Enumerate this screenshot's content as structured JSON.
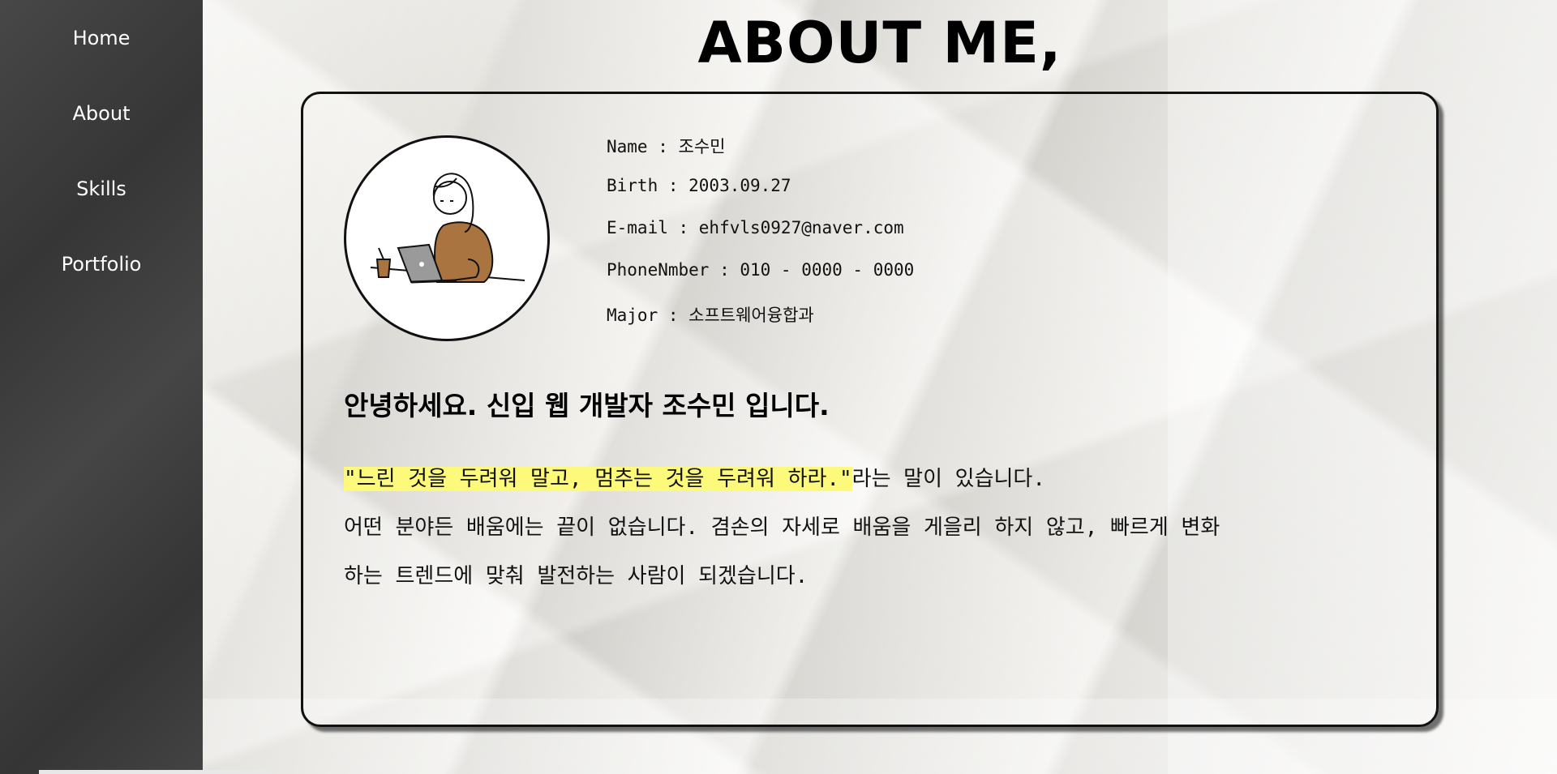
{
  "nav": {
    "items": [
      {
        "label": "Home"
      },
      {
        "label": "About"
      },
      {
        "label": "Skills"
      },
      {
        "label": "Portfolio"
      }
    ]
  },
  "page": {
    "title": "ABOUT ME,"
  },
  "profile": {
    "avatar_icon": "person-with-laptop-illustration",
    "name": "Name : 조수민",
    "birth": "Birth : 2003.09.27",
    "email": "E-mail : ehfvls0927@naver.com",
    "phone": "PhoneNmber : 010 - 0000 - 0000",
    "major": "Major : 소프트웨어융합과"
  },
  "intro": {
    "greeting": "안녕하세요. 신입 웹 개발자 조수민 입니다.",
    "quote": "\"느린 것을 두려워 말고, 멈추는 것을 두려워 하라.\"",
    "quote_suffix": "라는 말이 있습니다.",
    "line2": "어떤 분야든 배움에는 끝이 없습니다. 겸손의 자세로 배움을 게을리 하지 않고, 빠르게 변화",
    "line3": "하는 트렌드에 맞춰 발전하는 사람이 되겠습니다."
  },
  "colors": {
    "sidebar": "#3c3c3c",
    "highlight": "#fdf97b",
    "sweater": "#a9743f"
  }
}
